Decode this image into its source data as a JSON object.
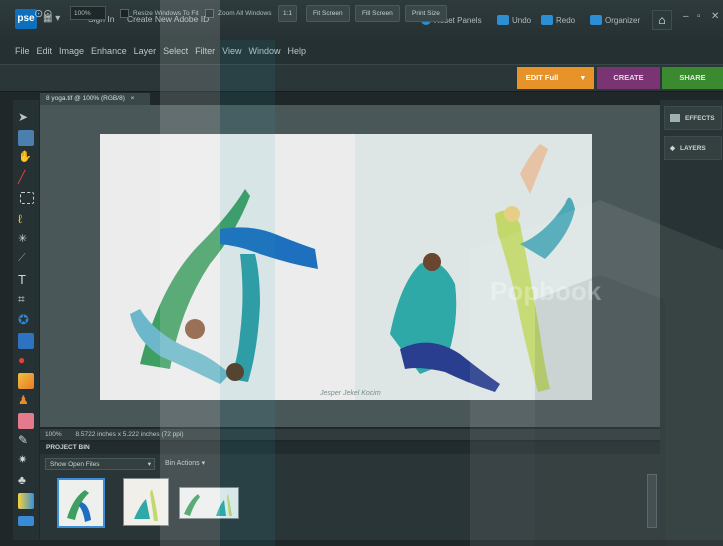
{
  "titlebar": {
    "logo": "pse",
    "sign_in": "Sign In",
    "create_id": "Create New Adobe ID",
    "reset_panels": "Reset Panels",
    "undo": "Undo",
    "redo": "Redo",
    "organizer": "Organizer",
    "minimize": "–",
    "restore": "▫",
    "close": "✕"
  },
  "menu": [
    "File",
    "Edit",
    "Image",
    "Enhance",
    "Layer",
    "Select",
    "Filter",
    "View",
    "Window",
    "Help"
  ],
  "options": {
    "zoom": "100%",
    "resize_windows": "Resize Windows To Fit",
    "zoom_all": "Zoom All Windows",
    "one_to_one": "1:1",
    "fit_screen": "Fit Screen",
    "fill_screen": "Fill Screen",
    "print_size": "Print Size"
  },
  "modes": {
    "edit": "EDIT Full",
    "create": "CREATE",
    "share": "SHARE"
  },
  "document": {
    "tab_title": "8 yoga.tif @ 100% (RGB/8)",
    "close": "×",
    "credit": "Jesper Jekel Kocim",
    "status_zoom": "100%",
    "status_info": "8.5722 inches x 5.222 inches (72 ppi)"
  },
  "panels": {
    "effects": "EFFECTS",
    "layers": "LAYERS"
  },
  "project_bin": {
    "title": "PROJECT BIN",
    "show": "Show Open Files",
    "actions": "Bin Actions"
  },
  "watermark": "Popbook",
  "colors": {
    "edit_tab": "#e8922a",
    "create_tab": "#7a3373",
    "share_tab": "#3c8a2f",
    "accent": "#2d8fd3"
  }
}
